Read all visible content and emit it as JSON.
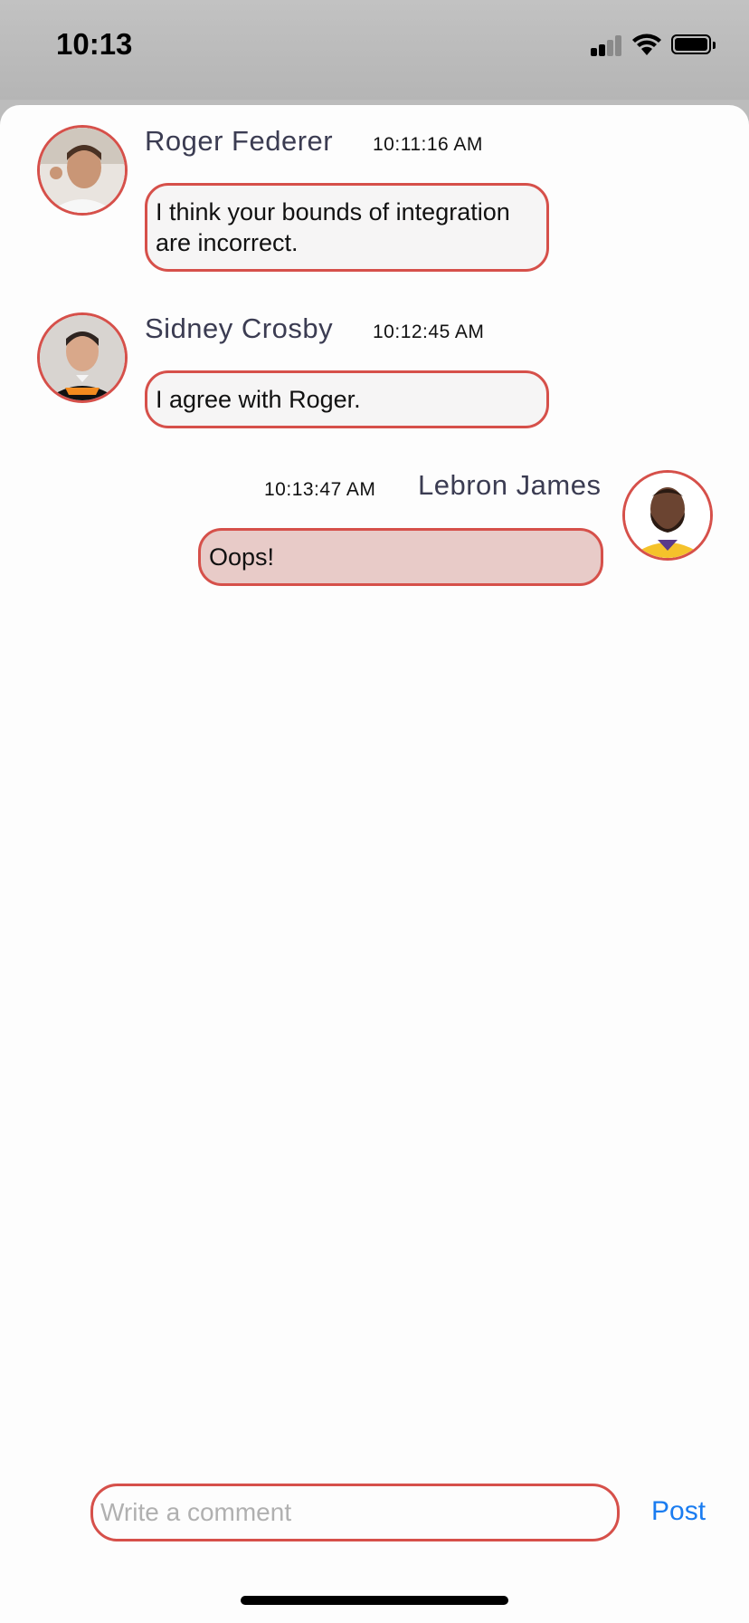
{
  "status_bar": {
    "time": "10:13",
    "icons": [
      "cellular-signal-icon",
      "wifi-icon",
      "battery-icon"
    ]
  },
  "messages": [
    {
      "author": "Roger Federer",
      "timestamp": "10:11:16 AM",
      "text": "I think your bounds of integration are incorrect.",
      "side": "left"
    },
    {
      "author": "Sidney Crosby",
      "timestamp": "10:12:45 AM",
      "text": "I agree with Roger.",
      "side": "left"
    },
    {
      "author": "Lebron James",
      "timestamp": "10:13:47 AM",
      "text": "Oops!",
      "side": "right"
    }
  ],
  "composer": {
    "placeholder": "Write a comment",
    "value": "",
    "post_label": "Post"
  },
  "colors": {
    "accent": "#d6504a",
    "bubble_other": "#f6f5f5",
    "bubble_self": "#e8cbc8",
    "name_text": "#3b3c52",
    "link_blue": "#1a7cf0"
  }
}
